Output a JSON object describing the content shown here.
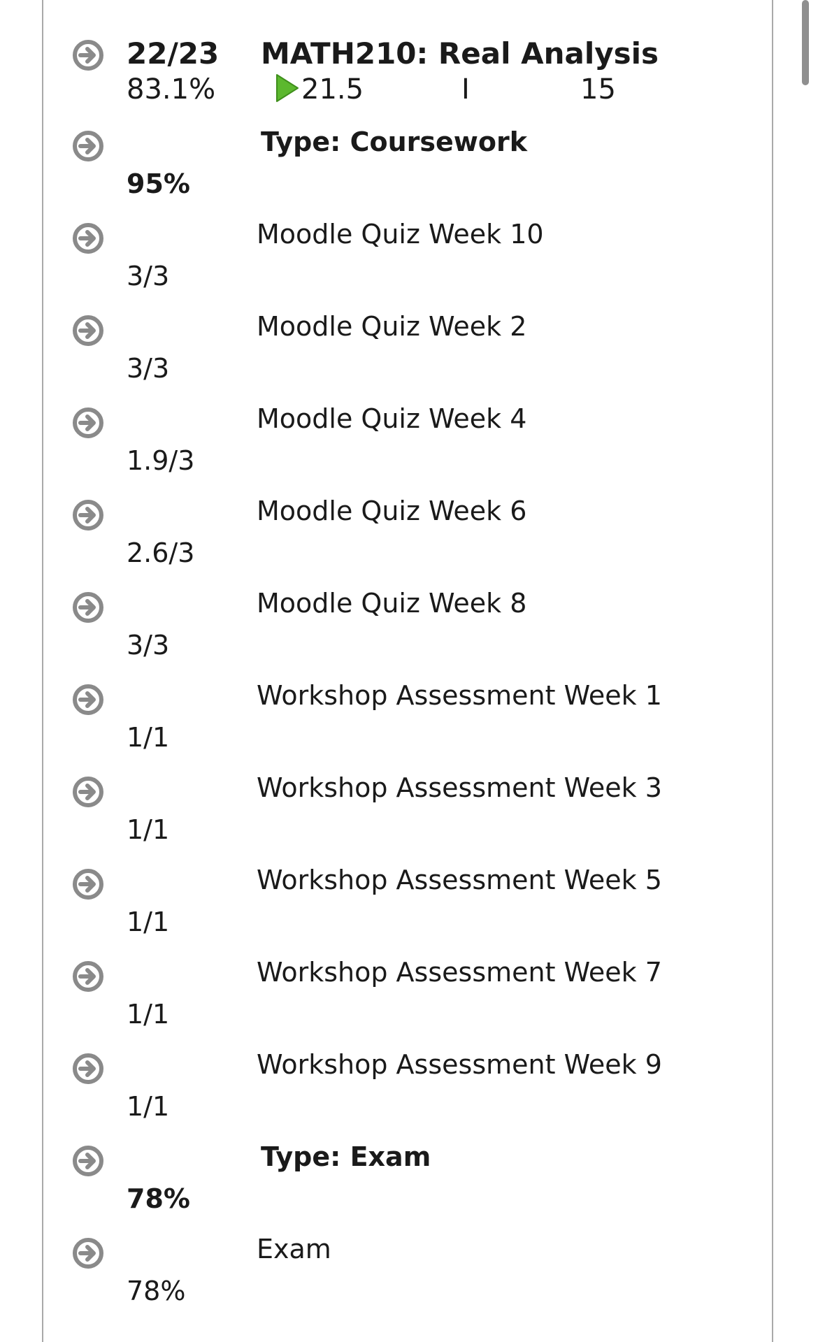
{
  "course": {
    "grade": "22/23",
    "title": "MATH210: Real Analysis",
    "percent": "83.1%",
    "play_value": "21.5",
    "status_letter": "I",
    "credits": "15",
    "play_icon": "green-play-icon"
  },
  "sections": [
    {
      "type_label": "Type: Coursework",
      "percent": "95%",
      "items": [
        {
          "name": "Moodle Quiz Week 10",
          "score": "3/3"
        },
        {
          "name": "Moodle Quiz Week 2",
          "score": "3/3"
        },
        {
          "name": "Moodle Quiz Week 4",
          "score": "1.9/3"
        },
        {
          "name": "Moodle Quiz Week 6",
          "score": "2.6/3"
        },
        {
          "name": "Moodle Quiz Week 8",
          "score": "3/3"
        },
        {
          "name": "Workshop Assessment Week 1",
          "score": "1/1"
        },
        {
          "name": "Workshop Assessment Week 3",
          "score": "1/1"
        },
        {
          "name": "Workshop Assessment Week 5",
          "score": "1/1"
        },
        {
          "name": "Workshop Assessment Week 7",
          "score": "1/1"
        },
        {
          "name": "Workshop Assessment Week 9",
          "score": "1/1"
        }
      ]
    },
    {
      "type_label": "Type: Exam",
      "percent": "78%",
      "items": [
        {
          "name": "Exam",
          "score": "78%"
        }
      ]
    }
  ],
  "icons": {
    "expand": "circle-arrow-right-icon",
    "color": "#8a8a8a"
  },
  "colors": {
    "play_green": "#5cb82e",
    "border": "#a9a9a9"
  }
}
